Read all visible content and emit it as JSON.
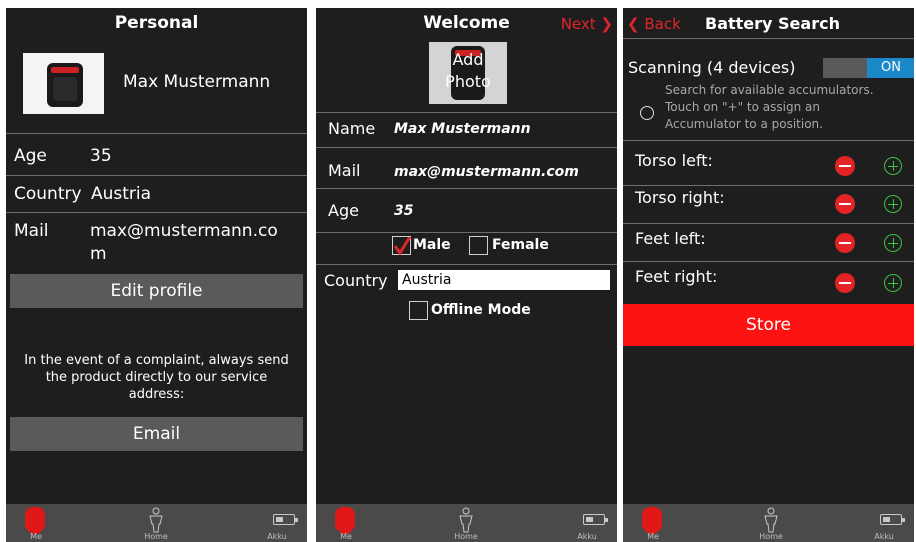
{
  "colors": {
    "background": "#1e1e1e",
    "accent_red": "#fd1212",
    "switch_blue": "#1b88c8",
    "plus_green": "#3fc33f"
  },
  "tabs": [
    {
      "label": "Me",
      "icon": "person-head-icon"
    },
    {
      "label": "Home",
      "icon": "body-figure-icon"
    },
    {
      "label": "Akku",
      "icon": "battery-icon"
    }
  ],
  "screen1": {
    "title": "Personal",
    "name": "Max Mustermann",
    "age_label": "Age",
    "age_value": "35",
    "country_label": "Country",
    "country_value": "Austria",
    "mail_label": "Mail",
    "mail_value_line1": "max@mustermann.co",
    "mail_value_line2": "m",
    "edit_button": "Edit profile",
    "complaint_text_line1": "In the event of a complaint, always send",
    "complaint_text_line2": "the product directly to our service",
    "complaint_text_line3": "address:",
    "email_button": "Email"
  },
  "screen2": {
    "title": "Welcome",
    "next_label": "Next",
    "photo_label_line1": "Add",
    "photo_label_line2": "Photo",
    "name_label": "Name",
    "name_value": "Max Mustermann",
    "mail_label": "Mail",
    "mail_value": "max@mustermann.com",
    "age_label": "Age",
    "age_value": "35",
    "male_label": "Male",
    "male_checked": true,
    "female_label": "Female",
    "female_checked": false,
    "country_label": "Country",
    "country_value": "Austria",
    "offline_label": "Offline Mode",
    "offline_checked": false
  },
  "screen3": {
    "title": "Battery Search",
    "back_label": "Back",
    "scanning_label": "Scanning (4 devices)",
    "switch_label": "ON",
    "hint_line1": "Search for available accumulators.",
    "hint_line2": "Touch on \"+\" to assign an",
    "hint_line3": "Accumulator to a position.",
    "positions": [
      "Torso left:",
      "Torso right:",
      "Feet left:",
      "Feet right:"
    ],
    "store_button": "Store"
  }
}
